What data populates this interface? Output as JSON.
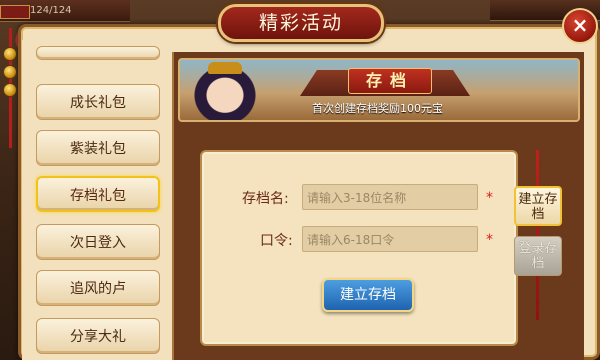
{
  "hud": {
    "hp_text": "124/124"
  },
  "dialog": {
    "title": "精彩活动",
    "close_label": "×"
  },
  "sidebar": {
    "items": [
      {
        "label": ""
      },
      {
        "label": "成长礼包"
      },
      {
        "label": "紫装礼包"
      },
      {
        "label": "存档礼包"
      },
      {
        "label": "次日登入"
      },
      {
        "label": "追风的卢"
      },
      {
        "label": "分享大礼"
      }
    ],
    "active_index": 3
  },
  "banner": {
    "title": "存档",
    "subtitle": "首次创建存档奖励100元宝"
  },
  "form": {
    "name_label": "存档名:",
    "name_placeholder": "请输入3-18位名称",
    "password_label": "口令:",
    "password_placeholder": "请输入6-18口令",
    "required_mark": "*",
    "submit_label": "建立存档"
  },
  "tabs": [
    {
      "label": "建立存档",
      "active": true
    },
    {
      "label": "登录存档",
      "active": false
    }
  ],
  "colors": {
    "accent_gold": "#f2c21a",
    "title_red": "#a3281c",
    "submit_blue": "#1e63b0"
  }
}
